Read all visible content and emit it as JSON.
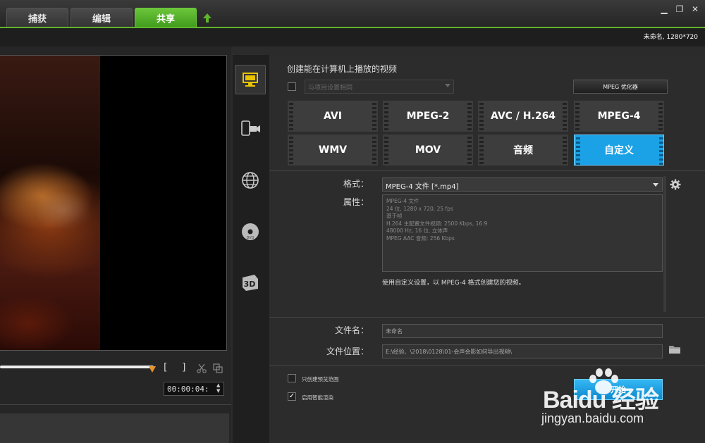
{
  "tabs": [
    {
      "label": "捕获",
      "active": false
    },
    {
      "label": "编辑",
      "active": false
    },
    {
      "label": "共享",
      "active": true
    }
  ],
  "window_controls": {
    "minimize": "▁",
    "restore": "❐",
    "close": "✕"
  },
  "project_info": "未命名, 1280*720",
  "preview": {
    "timecode": "00:00:04: ",
    "mark_in": "[",
    "mark_out": "]"
  },
  "side_icons": [
    "computer-icon",
    "mobile-device-icon",
    "web-icon",
    "disc-icon",
    "3d-icon"
  ],
  "share": {
    "heading": "创建能在计算机上播放的视频",
    "project_settings_placeholder": "与项目设置相同",
    "optimizer_label": "MPEG 优化器",
    "formats": [
      {
        "label": "AVI",
        "active": false
      },
      {
        "label": "MPEG-2",
        "active": false
      },
      {
        "label": "AVC / H.264",
        "active": false
      },
      {
        "label": "MPEG-4",
        "active": false
      },
      {
        "label": "WMV",
        "active": false
      },
      {
        "label": "MOV",
        "active": false
      },
      {
        "label": "音频",
        "active": false
      },
      {
        "label": "自定义",
        "active": true
      }
    ],
    "format_label": "格式：",
    "format_value": "MPEG-4 文件 [*.mp4]",
    "properties_label": "属性：",
    "properties": [
      "MPEG-4 文件",
      "24 位, 1280 x 720, 25 fps",
      "基于帧",
      "H.264 主配置文件视频: 2500 Kbps, 16:9",
      "48000 Hz, 16 位, 立体声",
      "MPEG AAC 音频: 256 Kbps"
    ],
    "description": "使用自定义设置，以 MPEG-4 格式创建您的视频。",
    "filename_label": "文件名：",
    "filename_value": "未命名",
    "location_label": "文件位置：",
    "location_value": "E:\\经验、\\2018\\0128\\01-会声会影如何导出视频\\",
    "option1_label": "只创建预览范围",
    "option1_checked": false,
    "option2_label": "启用智能渲染",
    "option2_checked": true,
    "start_label": "开始"
  },
  "watermark": {
    "logo": "Baidu 经验",
    "url": "jingyan.baidu.com"
  },
  "colors": {
    "accent_green": "#5fb52b",
    "accent_blue": "#1ba2e6"
  }
}
